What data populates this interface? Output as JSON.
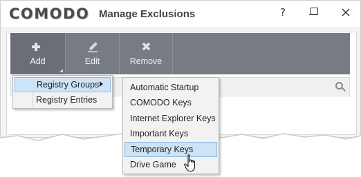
{
  "window": {
    "logo": "COMODO",
    "title": "Manage Exclusions",
    "controls": {
      "help": "?",
      "minimize": "—",
      "close": "✕"
    }
  },
  "toolbar": {
    "add": {
      "label": "Add",
      "icon": "plus-icon"
    },
    "edit": {
      "label": "Edit",
      "icon": "pencil-icon"
    },
    "remove": {
      "label": "Remove",
      "icon": "x-icon"
    }
  },
  "add_menu": {
    "items": [
      "Registry Groups",
      "Registry Entries"
    ],
    "highlighted": "Registry Groups"
  },
  "registry_groups_submenu": {
    "items": [
      "Automatic Startup",
      "COMODO Keys",
      "Internet Explorer Keys",
      "Important Keys",
      "Temporary Keys",
      "Drive Game"
    ],
    "highlighted": "Temporary Keys"
  },
  "colors": {
    "toolbar": "#777b84",
    "highlight": "#cde3f6",
    "highlight_border": "#8fb8df"
  }
}
